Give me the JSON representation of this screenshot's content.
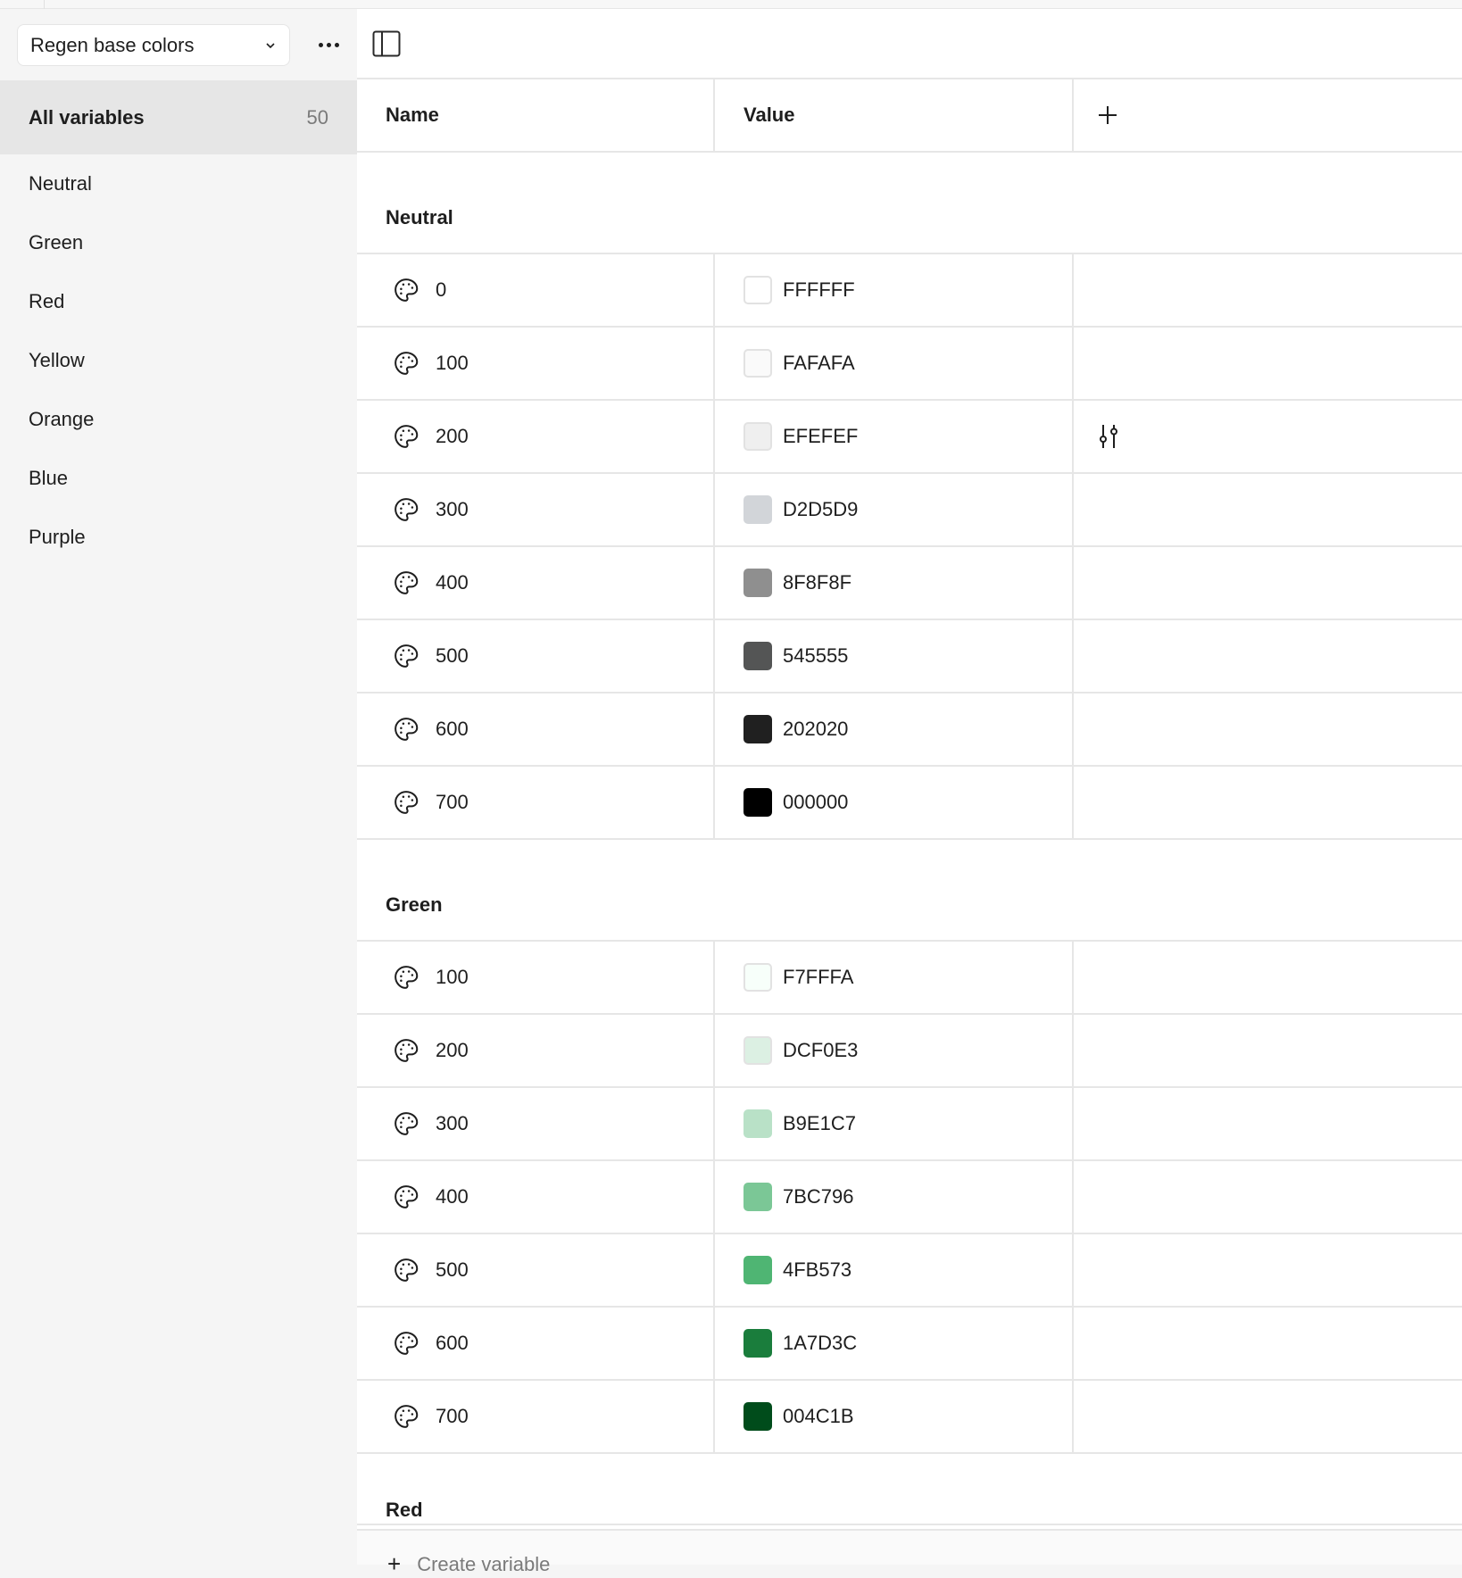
{
  "collection_selector": {
    "label": "Regen base colors"
  },
  "more_menu": {
    "label": "More options"
  },
  "sidebar": {
    "all_variables": {
      "label": "All variables",
      "count": "50"
    },
    "groups": [
      {
        "label": "Neutral"
      },
      {
        "label": "Green"
      },
      {
        "label": "Red"
      },
      {
        "label": "Yellow"
      },
      {
        "label": "Orange"
      },
      {
        "label": "Blue"
      },
      {
        "label": "Purple"
      }
    ]
  },
  "table": {
    "headers": {
      "name": "Name",
      "value": "Value",
      "add": "+"
    },
    "groups": [
      {
        "title": "Neutral",
        "rows": [
          {
            "name": "0",
            "hex": "FFFFFF",
            "color": "#FFFFFF",
            "light": true
          },
          {
            "name": "100",
            "hex": "FAFAFA",
            "color": "#FAFAFA",
            "light": true
          },
          {
            "name": "200",
            "hex": "EFEFEF",
            "color": "#EFEFEF",
            "light": true,
            "hovered": true
          },
          {
            "name": "300",
            "hex": "D2D5D9",
            "color": "#D2D5D9"
          },
          {
            "name": "400",
            "hex": "8F8F8F",
            "color": "#8F8F8F"
          },
          {
            "name": "500",
            "hex": "545555",
            "color": "#545555"
          },
          {
            "name": "600",
            "hex": "202020",
            "color": "#202020"
          },
          {
            "name": "700",
            "hex": "000000",
            "color": "#000000"
          }
        ]
      },
      {
        "title": "Green",
        "rows": [
          {
            "name": "100",
            "hex": "F7FFFA",
            "color": "#F7FFFA",
            "light": true
          },
          {
            "name": "200",
            "hex": "DCF0E3",
            "color": "#DCF0E3",
            "light": true
          },
          {
            "name": "300",
            "hex": "B9E1C7",
            "color": "#B9E1C7"
          },
          {
            "name": "400",
            "hex": "7BC796",
            "color": "#7BC796"
          },
          {
            "name": "500",
            "hex": "4FB573",
            "color": "#4FB573"
          },
          {
            "name": "600",
            "hex": "1A7D3C",
            "color": "#1A7D3C"
          },
          {
            "name": "700",
            "hex": "004C1B",
            "color": "#004C1B"
          }
        ]
      },
      {
        "title": "Red",
        "rows": []
      }
    ]
  },
  "footer": {
    "create_label": "Create variable"
  }
}
